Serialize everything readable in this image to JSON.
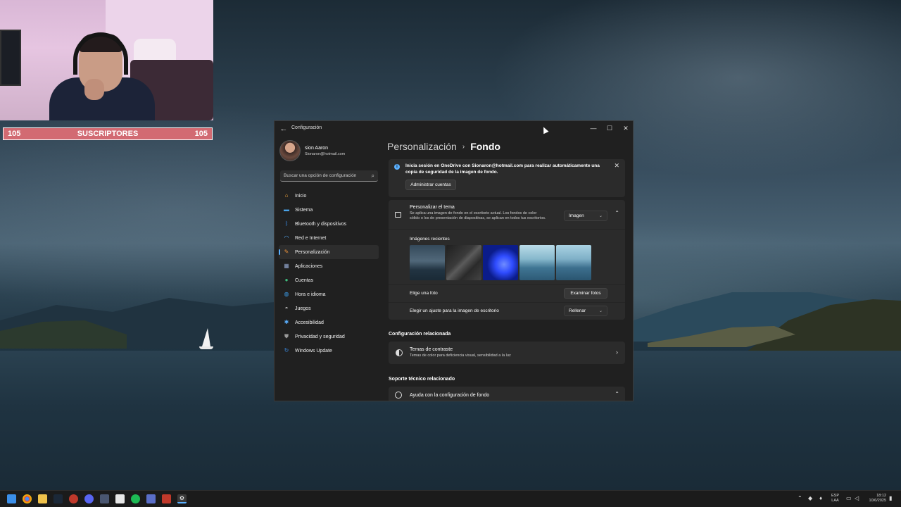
{
  "webcam": {
    "subscriber_count_left": "105",
    "subscriber_label": "SUSCRIPTORES",
    "subscriber_count_right": "105"
  },
  "window": {
    "title": "Configuración",
    "profile": {
      "name": "sion Aaron",
      "email": "Sionaron@hotmail.com"
    },
    "search": {
      "placeholder": "Buscar una opción de configuración"
    },
    "nav": [
      {
        "label": "Inicio",
        "icon": "home-icon",
        "color": "#f0a33c"
      },
      {
        "label": "Sistema",
        "icon": "system-icon",
        "color": "#4aa3e8"
      },
      {
        "label": "Bluetooth y dispositivos",
        "icon": "bluetooth-icon",
        "color": "#3b8ee8"
      },
      {
        "label": "Red e Internet",
        "icon": "wifi-icon",
        "color": "#5ab0ff"
      },
      {
        "label": "Personalización",
        "icon": "brush-icon",
        "color": "#e8913b"
      },
      {
        "label": "Aplicaciones",
        "icon": "apps-icon",
        "color": "#8fa2c8"
      },
      {
        "label": "Cuentas",
        "icon": "account-icon",
        "color": "#3fbf7f"
      },
      {
        "label": "Hora e idioma",
        "icon": "globe-time-icon",
        "color": "#3b9be8"
      },
      {
        "label": "Juegos",
        "icon": "gamepad-icon",
        "color": "#bcbcbc"
      },
      {
        "label": "Accesibilidad",
        "icon": "accessibility-icon",
        "color": "#5ab0ff"
      },
      {
        "label": "Privacidad y seguridad",
        "icon": "shield-icon",
        "color": "#9a9a9a"
      },
      {
        "label": "Windows Update",
        "icon": "update-icon",
        "color": "#3b8ee8"
      }
    ],
    "active_nav": "Personalización",
    "breadcrumb": {
      "parent": "Personalización",
      "separator": "›",
      "current": "Fondo"
    },
    "banner": {
      "text": "Inicia sesión en OneDrive con Sionaron@hotmail.com para realizar automáticamente una copia de seguridad de la imagen de fondo.",
      "button": "Administrar cuentas"
    },
    "background": {
      "title": "Personalizar el tema",
      "description": "Se aplica una imagen de fondo en el escritorio actual. Los fondos de color sólido o los de presentación de diapositivas, se aplican en todos tus escritorios.",
      "type_selected": "Imagen",
      "recent_label": "Imágenes recientes",
      "choose_photo_label": "Elige una foto",
      "browse_button": "Examinar fotos",
      "fit_label": "Elegir un ajuste para la imagen de escritorio",
      "fit_selected": "Rellenar"
    },
    "related": {
      "title": "Configuración relacionada",
      "contrast_title": "Temas de contraste",
      "contrast_desc": "Temas de color para deficiencia visual, sensibilidad a la luz"
    },
    "support": {
      "title": "Soporte técnico relacionado",
      "help_title": "Ayuda con la configuración de fondo"
    }
  },
  "taskbar": {
    "language_line1": "ESP",
    "language_line2": "LAA",
    "time": "18:12",
    "date": "10/6/2025"
  }
}
